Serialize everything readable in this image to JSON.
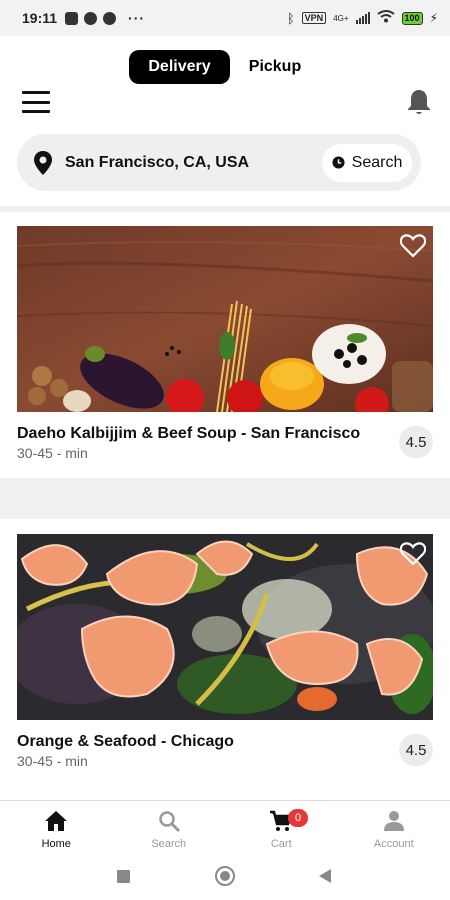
{
  "status_bar": {
    "time": "19:11",
    "dots": "···",
    "vpn": "VPN",
    "network": "4G+",
    "battery": "100"
  },
  "header": {
    "tabs": [
      {
        "label": "Delivery",
        "active": true
      },
      {
        "label": "Pickup",
        "active": false
      }
    ],
    "menu_icon": "hamburger-icon",
    "notification_icon": "bell-icon"
  },
  "search": {
    "location": "San Francisco, CA, USA",
    "button_label": "Search"
  },
  "restaurants": [
    {
      "name": "Daeho Kalbijjim & Beef Soup - San Francisco",
      "time": "30-45 - min",
      "rating": "4.5",
      "image": "vegetables-pasta-on-wooden-table",
      "favorite": false
    },
    {
      "name": "Orange & Seafood - Chicago",
      "time": "30-45 - min",
      "rating": "4.5",
      "image": "shrimp-salad",
      "favorite": false
    }
  ],
  "bottom_nav": {
    "items": [
      {
        "label": "Home",
        "icon": "home-icon",
        "active": true
      },
      {
        "label": "Search",
        "icon": "search-icon",
        "active": false
      },
      {
        "label": "Cart",
        "icon": "cart-icon",
        "active": false,
        "badge": "0"
      },
      {
        "label": "Account",
        "icon": "account-icon",
        "active": false
      }
    ]
  },
  "colors": {
    "accent": "#000000",
    "badge": "#e53935",
    "inactive": "#999999"
  }
}
